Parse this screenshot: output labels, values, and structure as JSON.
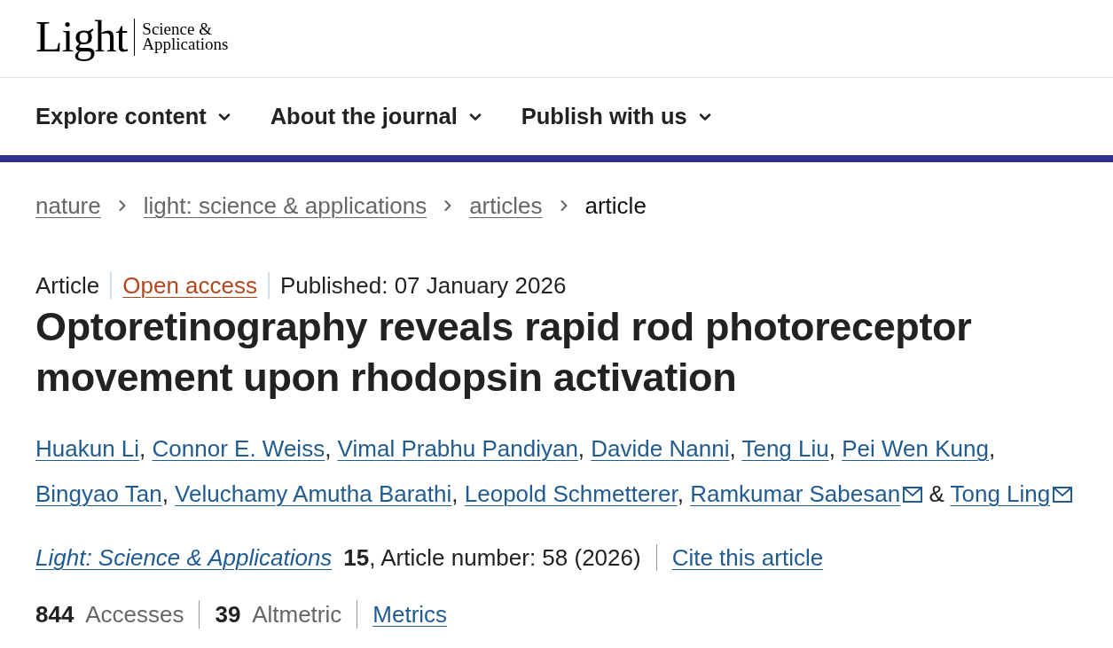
{
  "header": {
    "logo": {
      "wordmark": "Light",
      "subtitle_lines": [
        "Science &",
        "Applications"
      ]
    }
  },
  "nav": [
    {
      "label": "Explore content"
    },
    {
      "label": "About the journal"
    },
    {
      "label": "Publish with us"
    }
  ],
  "breadcrumbs": [
    {
      "label": "nature",
      "kind": "link"
    },
    {
      "label": "light: science & applications",
      "kind": "link"
    },
    {
      "label": "articles",
      "kind": "link"
    },
    {
      "label": "article",
      "kind": "current"
    }
  ],
  "article": {
    "type": "Article",
    "access": "Open access",
    "published": "Published: 07 January 2026",
    "title": "Optoretinography reveals rapid rod photoreceptor movement upon rhodopsin activation",
    "authors": [
      {
        "name": "Huakun Li",
        "email": false,
        "separator": ","
      },
      {
        "name": "Connor E. Weiss",
        "email": false,
        "separator": ","
      },
      {
        "name": "Vimal Prabhu Pandiyan",
        "email": false,
        "separator": ","
      },
      {
        "name": "Davide Nanni",
        "email": false,
        "separator": ","
      },
      {
        "name": "Teng Liu",
        "email": false,
        "separator": ","
      },
      {
        "name": "Pei Wen Kung",
        "email": false,
        "separator": ","
      },
      {
        "name": "Bingyao Tan",
        "email": false,
        "separator": ","
      },
      {
        "name": "Veluchamy Amutha Barathi",
        "email": false,
        "separator": ","
      },
      {
        "name": "Leopold Schmetterer",
        "email": false,
        "separator": ","
      },
      {
        "name": "Ramkumar Sabesan",
        "email": true,
        "separator": "&"
      },
      {
        "name": "Tong Ling",
        "email": true
      }
    ],
    "citation": {
      "journal": "Light: Science & Applications",
      "details": "**15**, Article number: 58 (2026)",
      "cite_link": "Cite this article"
    },
    "metrics": [
      "**844** Accesses",
      "**39** Altmetric"
    ],
    "metrics_link": "Metrics"
  }
}
